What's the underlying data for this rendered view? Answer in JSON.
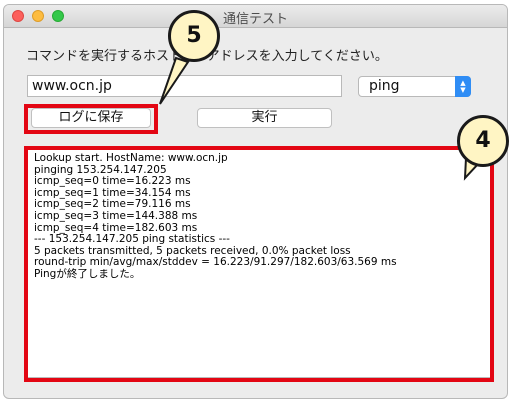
{
  "window": {
    "title": "通信テスト"
  },
  "form": {
    "instruction": "コマンドを実行するホストのIPアドレスを入力してください。",
    "host_value": "www.ocn.jp",
    "command_value": "ping",
    "save_label": "ログに保存",
    "run_label": "実行"
  },
  "log": {
    "lines": [
      "Lookup start. HostName: www.ocn.jp",
      "pinging 153.254.147.205",
      "icmp_seq=0 time=16.223 ms",
      "icmp_seq=1 time=34.154 ms",
      "icmp_seq=2 time=79.116 ms",
      "icmp_seq=3 time=144.388 ms",
      "icmp_seq=4 time=182.603 ms",
      "--- 153.254.147.205 ping statistics ---",
      "5 packets transmitted, 5 packets received,   0.0% packet loss",
      "round-trip min/avg/max/stddev = 16.223/91.297/182.603/63.569 ms",
      "Pingが終了しました。"
    ]
  },
  "callouts": {
    "save": "5",
    "log": "4"
  },
  "colors": {
    "highlight": "#e30613",
    "callout_fill": "#fff5c4",
    "select_accent": "#2f8df5"
  }
}
